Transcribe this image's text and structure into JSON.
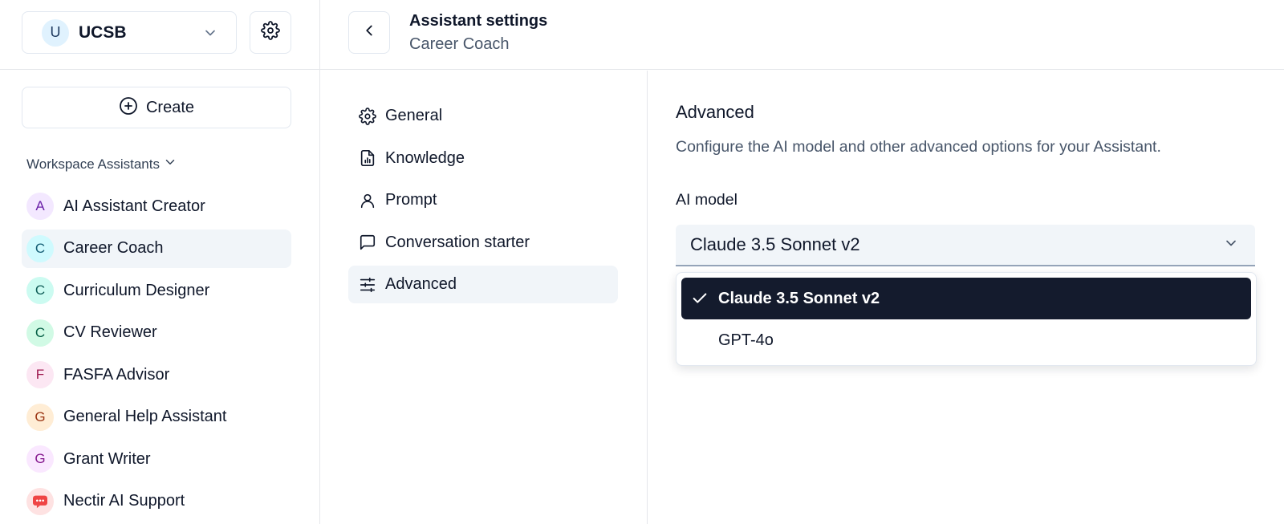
{
  "workspace": {
    "avatar_letter": "U",
    "name": "UCSB"
  },
  "sidebar": {
    "create_label": "Create",
    "section_title": "Workspace Assistants",
    "assistants": [
      {
        "letter": "A",
        "name": "AI Assistant Creator",
        "bg": "#f3e8ff",
        "fg": "#6b21a8",
        "active": false
      },
      {
        "letter": "C",
        "name": "Career Coach",
        "bg": "#cffafe",
        "fg": "#155e75",
        "active": true
      },
      {
        "letter": "C",
        "name": "Curriculum Designer",
        "bg": "#ccfbf1",
        "fg": "#115e59",
        "active": false
      },
      {
        "letter": "C",
        "name": "CV Reviewer",
        "bg": "#d1fae5",
        "fg": "#065f46",
        "active": false
      },
      {
        "letter": "F",
        "name": "FASFA Advisor",
        "bg": "#fce7f3",
        "fg": "#9d174d",
        "active": false
      },
      {
        "letter": "G",
        "name": "General Help Assistant",
        "bg": "#ffedd5",
        "fg": "#9a3412",
        "active": false
      },
      {
        "letter": "G",
        "name": "Grant Writer",
        "bg": "#fae8ff",
        "fg": "#86198f",
        "active": false
      },
      {
        "letter": "",
        "name": "Nectir AI Support",
        "bg": "#fee2e2",
        "fg": "#ef4444",
        "active": false,
        "icon": "chat-bubble-icon"
      }
    ]
  },
  "header": {
    "title": "Assistant settings",
    "subtitle": "Career Coach"
  },
  "settings_nav": [
    {
      "label": "General",
      "icon": "gear-icon",
      "active": false
    },
    {
      "label": "Knowledge",
      "icon": "document-chart-icon",
      "active": false
    },
    {
      "label": "Prompt",
      "icon": "user-icon",
      "active": false
    },
    {
      "label": "Conversation starter",
      "icon": "chat-icon",
      "active": false
    },
    {
      "label": "Advanced",
      "icon": "sliders-icon",
      "active": true
    }
  ],
  "advanced": {
    "heading": "Advanced",
    "description": "Configure the AI model and other advanced options for your Assistant.",
    "model_label": "AI model",
    "selected_model": "Claude 3.5 Sonnet v2",
    "options": [
      {
        "label": "Claude 3.5 Sonnet v2",
        "selected": true
      },
      {
        "label": "GPT-4o",
        "selected": false
      }
    ]
  },
  "colors": {
    "accent_dark": "#141b2d",
    "active_bg": "#f1f5f9",
    "border": "#e2e8f0"
  }
}
